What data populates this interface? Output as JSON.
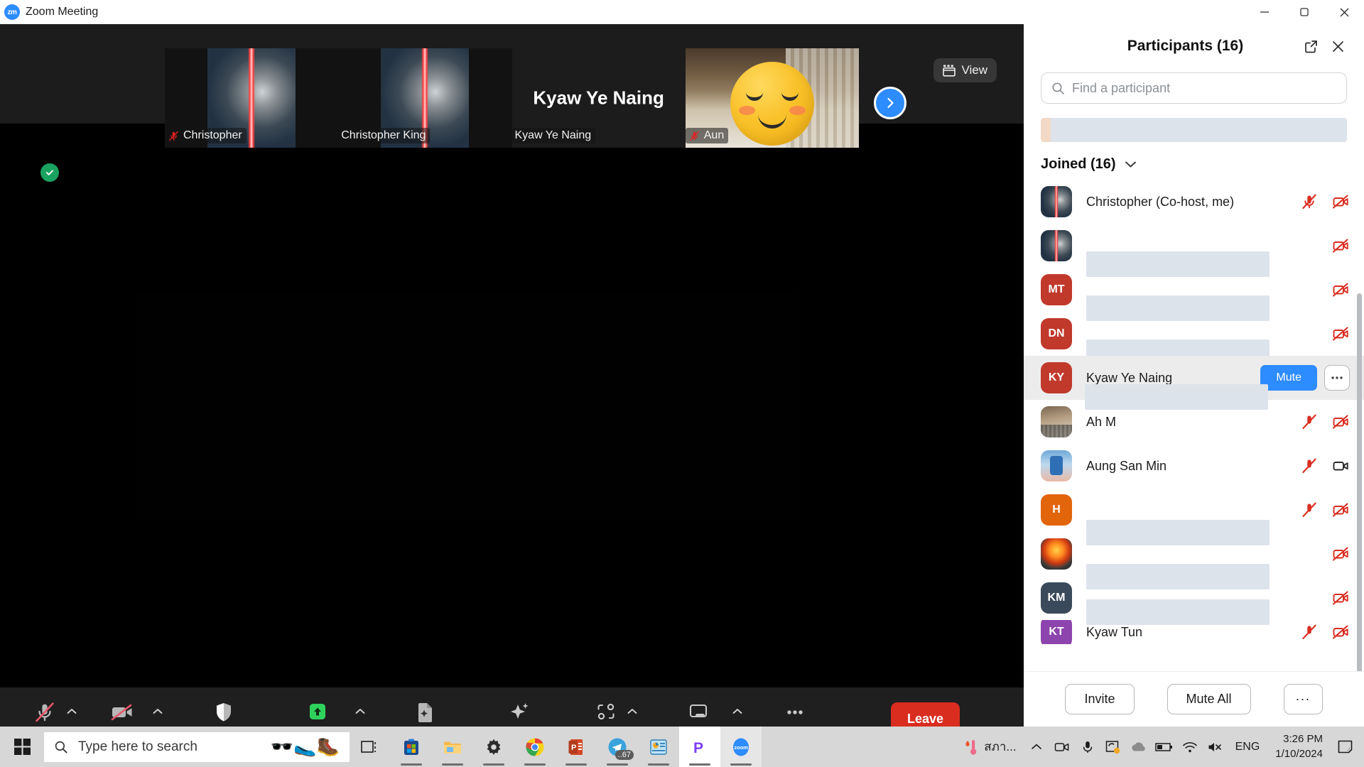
{
  "window": {
    "title": "Zoom Meeting",
    "logo_text": "zm",
    "minimize_icon": "minimize-icon",
    "maximize_icon": "maximize-icon",
    "close_icon": "close-icon"
  },
  "stage": {
    "view_button": "View",
    "view_icon": "grid-view-icon",
    "next_page_icon": "chevron-right-icon",
    "security_ok_icon": "shield-check-icon"
  },
  "filmstrip": {
    "tiles": [
      {
        "name": "Christopher",
        "muted": true,
        "kind": "kylo-avatar",
        "big_name": ""
      },
      {
        "name": "Christopher King",
        "muted": false,
        "kind": "kylo-avatar",
        "big_name": ""
      },
      {
        "name": "Kyaw Ye Naing",
        "muted": false,
        "kind": "name-only",
        "big_name": "Kyaw Ye Naing"
      },
      {
        "name": "Aun",
        "muted": true,
        "kind": "photo-emoji",
        "big_name": ""
      }
    ]
  },
  "toolbar": {
    "items": [
      {
        "label": "Unmute",
        "icon": "microphone-muted-icon",
        "caret": true,
        "accent": false
      },
      {
        "label": "Start Video",
        "icon": "camera-muted-icon",
        "caret": true,
        "accent": false
      },
      {
        "label": "Security",
        "icon": "shield-icon",
        "caret": false,
        "accent": false
      },
      {
        "label": "Share Screen",
        "icon": "share-screen-icon",
        "caret": true,
        "accent": true
      },
      {
        "label": "Summary",
        "icon": "summary-document-icon",
        "caret": false,
        "accent": false
      },
      {
        "label": "AI Companion",
        "icon": "ai-sparkle-icon",
        "caret": false,
        "accent": false
      },
      {
        "label": "Apps",
        "icon": "apps-icon",
        "caret": true,
        "accent": false
      },
      {
        "label": "Whiteboards",
        "icon": "whiteboard-icon",
        "caret": true,
        "accent": false
      },
      {
        "label": "More",
        "icon": "more-dots-icon",
        "caret": false,
        "accent": false
      }
    ],
    "leave_label": "Leave"
  },
  "panel": {
    "title": "Participants (16)",
    "popout_icon": "pop-out-icon",
    "close_icon": "close-icon",
    "search": {
      "placeholder": "Find a participant",
      "value": "",
      "icon": "search-icon"
    },
    "section_header": "Joined (16)",
    "section_caret_icon": "chevron-down-icon",
    "rows": [
      {
        "name": "Christopher (Co-host, me)",
        "redacted": false,
        "avatar_kind": "kylo",
        "initials": "",
        "mic": "muted",
        "cam": "off",
        "hover": false,
        "raise_hand": false
      },
      {
        "name": "",
        "redacted": true,
        "redact_width": 258,
        "avatar_kind": "kylo",
        "initials": "",
        "mic": "none",
        "cam": "off",
        "hover": false,
        "raise_hand": false
      },
      {
        "name": "",
        "redacted": true,
        "redact_width": 258,
        "avatar_kind": "initials-red",
        "initials": "MT",
        "mic": "none",
        "cam": "off",
        "hover": false,
        "raise_hand": true
      },
      {
        "name": "",
        "redacted": true,
        "redact_width": 258,
        "avatar_kind": "initials-red",
        "initials": "DN",
        "mic": "none",
        "cam": "off",
        "hover": false,
        "raise_hand": true
      },
      {
        "name": "Kyaw Ye Naing",
        "redacted": true,
        "redact_width": 258,
        "avatar_kind": "initials-red",
        "initials": "KY",
        "mic": "none",
        "cam": "none",
        "hover": true,
        "raise_hand": false,
        "mute_label": "Mute",
        "more_icon": "more-dots-icon"
      },
      {
        "name": "Ah M",
        "redacted": true,
        "redact_width": 258,
        "avatar_kind": "photo1",
        "initials": "",
        "mic": "muted",
        "cam": "off",
        "hover": false,
        "raise_hand": false
      },
      {
        "name": "Aung San Min",
        "redacted": true,
        "redact_width": 258,
        "avatar_kind": "photo2",
        "initials": "",
        "mic": "muted",
        "cam": "on",
        "hover": false,
        "raise_hand": false
      },
      {
        "name": "",
        "redacted": true,
        "redact_width": 258,
        "avatar_kind": "initials-orange",
        "initials": "H",
        "mic": "muted",
        "cam": "off",
        "hover": false,
        "raise_hand": false
      },
      {
        "name": "",
        "redacted": true,
        "redact_width": 258,
        "avatar_kind": "flame",
        "initials": "",
        "mic": "muted",
        "cam": "off",
        "hover": false,
        "raise_hand": false
      },
      {
        "name": "",
        "redacted": true,
        "redact_width": 258,
        "avatar_kind": "initials-navy",
        "initials": "KM",
        "mic": "none",
        "cam": "off",
        "hover": false,
        "raise_hand": false
      },
      {
        "name": "Kyaw Tun",
        "redacted": false,
        "avatar_kind": "initials-purple",
        "initials": "KT",
        "mic": "muted",
        "cam": "off",
        "hover": false,
        "raise_hand": false
      }
    ],
    "footer": {
      "invite_label": "Invite",
      "mute_all_label": "Mute All",
      "more_label": "···"
    }
  },
  "taskbar": {
    "start_icon": "windows-start-icon",
    "search_placeholder": "Type here to search",
    "search_value": "",
    "search_icon": "search-icon",
    "search_emoji": "🕶️🥿🥾",
    "task_view_icon": "task-view-icon",
    "apps": [
      {
        "name": "microsoft-store-icon",
        "glyph": "",
        "badge": "",
        "active": false
      },
      {
        "name": "file-explorer-icon",
        "glyph": "",
        "badge": "",
        "active": false
      },
      {
        "name": "settings-gear-icon",
        "glyph": "",
        "badge": "",
        "active": false
      },
      {
        "name": "google-chrome-icon",
        "glyph": "",
        "badge": "",
        "active": false
      },
      {
        "name": "powerpoint-icon",
        "glyph": "P",
        "badge": "",
        "active": false
      },
      {
        "name": "telegram-icon",
        "glyph": "",
        "badge": "..67",
        "active": false
      },
      {
        "name": "dashboard-app-icon",
        "glyph": "",
        "badge": "",
        "active": false
      },
      {
        "name": "perplexity-icon",
        "glyph": "P",
        "badge": "",
        "active": false
      },
      {
        "name": "zoom-icon",
        "glyph": "zoom",
        "badge": "",
        "active": true
      }
    ],
    "tray": {
      "weather_icon": "thermometer-icon",
      "weather_text": "สภา...",
      "overflow_icon": "chevron-up-icon",
      "camera_icon": "camera-in-use-icon",
      "microphone_icon": "microphone-in-use-icon",
      "onedrive_sync_icon": "onedrive-sync-icon",
      "cloud_icon": "cloud-icon",
      "battery_icon": "battery-icon",
      "wifi_icon": "wifi-icon",
      "volume_icon": "volume-muted-icon",
      "language": "ENG",
      "time": "3:26 PM",
      "date": "1/10/2024",
      "notification_icon": "notification-bell-icon"
    }
  },
  "colors": {
    "accent_blue": "#2d8cff",
    "leave_red": "#d92d20",
    "share_green": "#2fd35c",
    "mute_red": "#e02020",
    "panel_bg": "#ffffff",
    "stage_bg": "#000000"
  }
}
